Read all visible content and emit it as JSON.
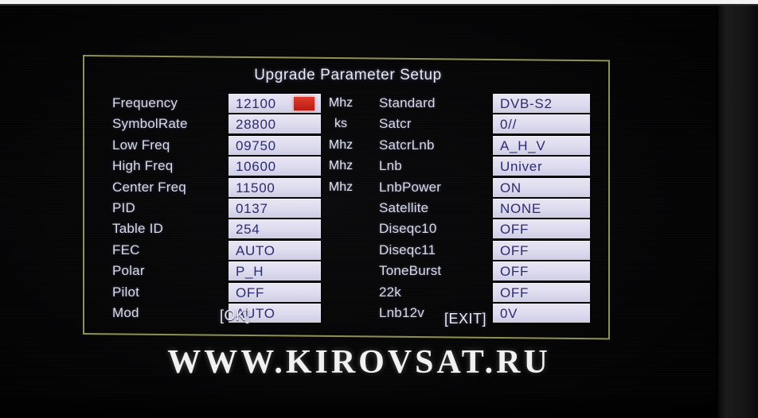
{
  "screen": {
    "title": "Upgrade Parameter Setup",
    "watermark": "WWW.KIROVSAT.RU",
    "border_color": "#8f9150",
    "value_text_color": "#2a2a6e",
    "highlight_color": "#d02a1c"
  },
  "left_column": [
    {
      "label": "Frequency",
      "value": "12100",
      "unit": "Mhz",
      "marked": true
    },
    {
      "label": "SymbolRate",
      "value": "28800",
      "unit": "ks",
      "marked": false
    },
    {
      "label": "Low Freq",
      "value": "09750",
      "unit": "Mhz",
      "marked": false
    },
    {
      "label": "High Freq",
      "value": "10600",
      "unit": "Mhz",
      "marked": false
    },
    {
      "label": "Center Freq",
      "value": "11500",
      "unit": "Mhz",
      "marked": false
    },
    {
      "label": "PID",
      "value": "0137",
      "unit": "",
      "marked": false
    },
    {
      "label": "Table ID",
      "value": "254",
      "unit": "",
      "marked": false
    },
    {
      "label": "FEC",
      "value": "AUTO",
      "unit": "",
      "marked": false
    },
    {
      "label": "Polar",
      "value": "P_H",
      "unit": "",
      "marked": false
    },
    {
      "label": "Pilot",
      "value": "OFF",
      "unit": "",
      "marked": false
    },
    {
      "label": "Mod",
      "value": "AUTO",
      "unit": "",
      "marked": false
    }
  ],
  "right_column": [
    {
      "label": "Standard",
      "value": "DVB-S2"
    },
    {
      "label": "Satcr",
      "value": "0//"
    },
    {
      "label": "SatcrLnb",
      "value": "A_H_V"
    },
    {
      "label": "Lnb",
      "value": "Univer"
    },
    {
      "label": "LnbPower",
      "value": "ON"
    },
    {
      "label": "Satellite",
      "value": "NONE"
    },
    {
      "label": "Diseqc10",
      "value": "OFF"
    },
    {
      "label": "Diseqc11",
      "value": "OFF"
    },
    {
      "label": "ToneBurst",
      "value": "OFF"
    },
    {
      "label": "22k",
      "value": "OFF"
    },
    {
      "label": "Lnb12v",
      "value": "0V"
    }
  ],
  "buttons": {
    "ok": "[OK]",
    "exit": "[EXIT]"
  }
}
